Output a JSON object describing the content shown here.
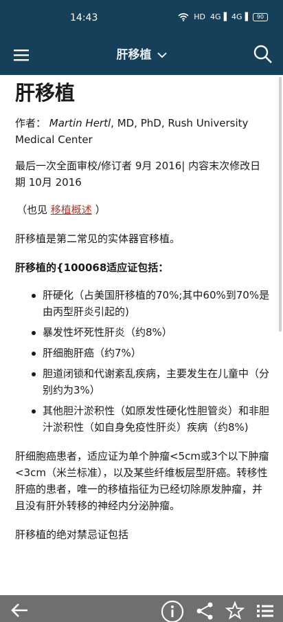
{
  "status_bar": {
    "time": "14:43",
    "network": "HD",
    "signal1": "4G",
    "signal2": "4G",
    "battery": "90"
  },
  "app_bar": {
    "title": "肝移植",
    "icons": [
      "menu-icon",
      "chevron-down-icon",
      "search-icon"
    ]
  },
  "article": {
    "title": "肝移植",
    "author_label": "作者：",
    "author_name": "Martin Hertl",
    "author_rest": ", MD, PhD, Rush University Medical Center",
    "review_line": "最后一次全面审校/修订者 9月 2016| 内容末次修改日期 10月 2016",
    "see_also_prefix": "（也见",
    "see_also_link": "移植概述",
    "see_also_suffix": "）",
    "intro": "肝移植是第二常见的实体器官移植。",
    "indications_heading": "肝移植的{100068适应证包括：",
    "indications": [
      "肝硬化（占美国肝移植的70%;其中60%到70%是由丙型肝炎引起的)",
      "暴发性坏死性肝炎（约8%）",
      "肝细胞肝癌（约7%）",
      "胆道闭锁和代谢紊乱疾病，主要发生在儿童中（分别约为3%）",
      "其他胆汁淤积性（如原发性硬化性胆管炎）和非胆汁淤积性（如自身免疫性肝炎）疾病（约8%)"
    ],
    "hcc_paragraph": "肝细胞癌患者，适应证为单个肿瘤<5cm或3个以下肿瘤<3cm（米兰标准），以及某些纤维板层型肝癌。转移性肝癌的患者，唯一的移植指征为已经切除原发肿瘤，并且没有肝外转移的神经内分泌肿瘤。",
    "contra_heading": "肝移植的绝对禁忌证包括"
  },
  "bottom_bar": {
    "icons": [
      "back-arrow-icon",
      "info-icon",
      "share-icon",
      "star-icon",
      "list-icon"
    ]
  },
  "colors": {
    "header": "#163f59",
    "link": "#b03a2e",
    "bottom_bar": "#6f6f6f"
  }
}
